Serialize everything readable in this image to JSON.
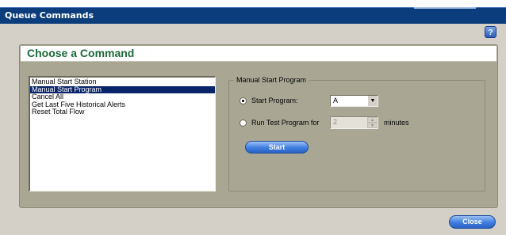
{
  "window": {
    "title": "Queue Commands"
  },
  "help_button": {
    "icon": "question-icon",
    "glyph": "?"
  },
  "panel": {
    "title": "Choose a Command"
  },
  "command_list": {
    "items": [
      {
        "label": "Manual Start Station",
        "selected": false
      },
      {
        "label": "Manual Start Program",
        "selected": true
      },
      {
        "label": "Cancel All",
        "selected": false
      },
      {
        "label": "Get Last Five Historical Alerts",
        "selected": false
      },
      {
        "label": "Reset Total Flow",
        "selected": false
      }
    ]
  },
  "manual_start_program": {
    "legend": "Manual Start Program",
    "start_program": {
      "label": "Start Program:",
      "checked": true,
      "value": "A"
    },
    "run_test": {
      "label": "Run Test Program for",
      "checked": false,
      "value": "2",
      "units": "minutes"
    },
    "start_button": "Start"
  },
  "footer": {
    "close_button": "Close"
  },
  "colors": {
    "titlebar": "#0b3c7c",
    "panel_title": "#1a6a3a",
    "button": "#3f7ee0"
  }
}
